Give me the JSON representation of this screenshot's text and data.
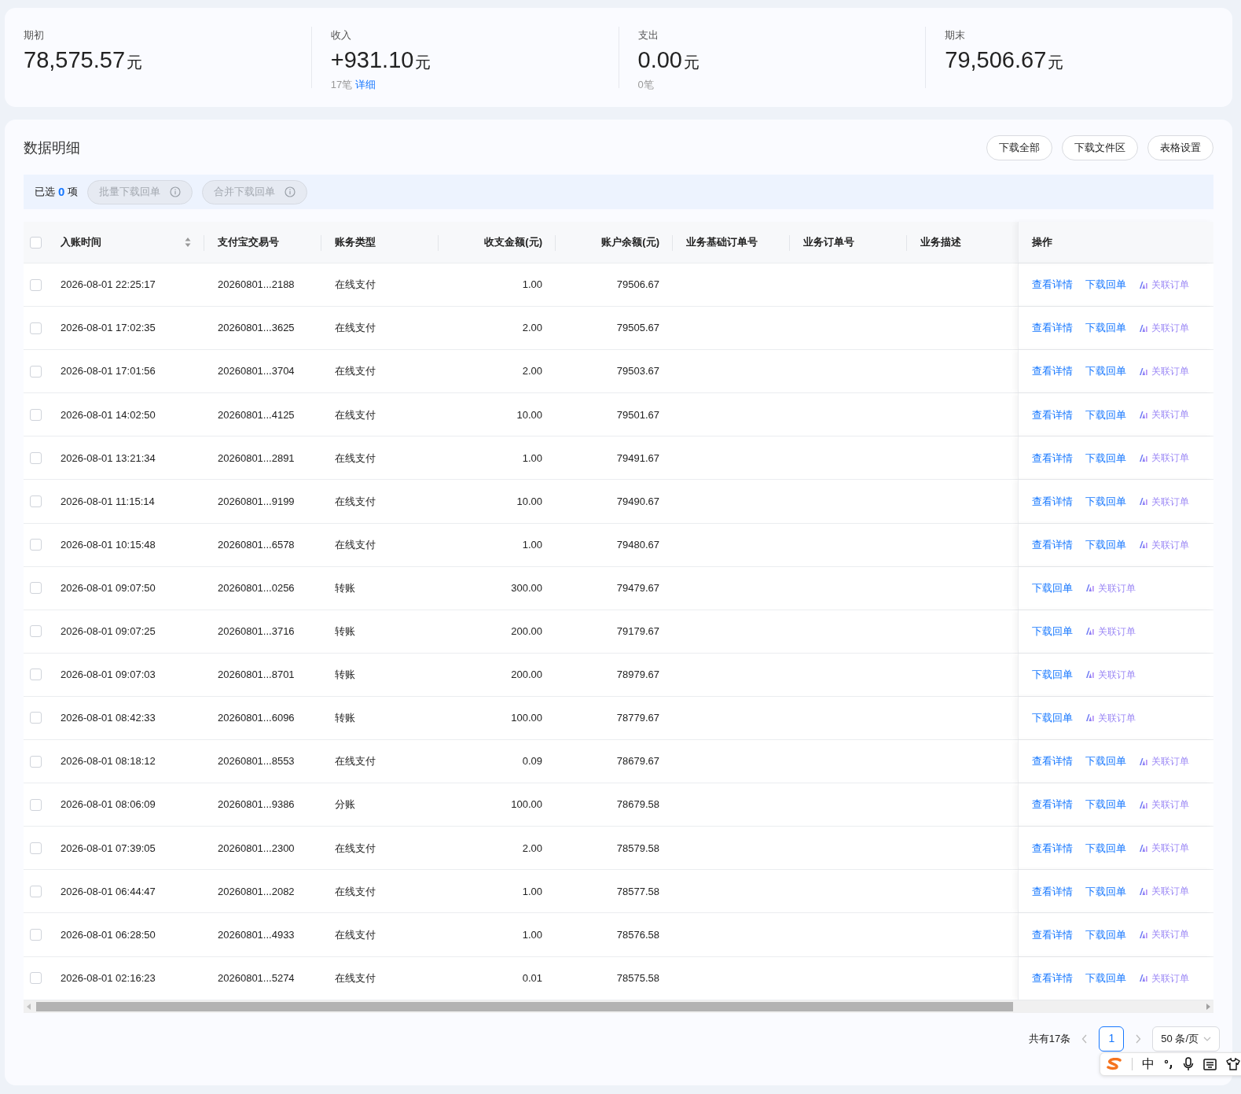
{
  "summary": [
    {
      "label": "期初",
      "amount": "78,575.57",
      "unit": "元"
    },
    {
      "label": "收入",
      "amount": "+931.10",
      "unit": "元",
      "count": "17笔",
      "link": "详细"
    },
    {
      "label": "支出",
      "amount": "0.00",
      "unit": "元",
      "count": "0笔"
    },
    {
      "label": "期末",
      "amount": "79,506.67",
      "unit": "元"
    }
  ],
  "detail": {
    "title": "数据明细",
    "buttons": [
      "下载全部",
      "下载文件区",
      "表格设置"
    ],
    "selection": {
      "prefix": "已选",
      "count": "0",
      "suffix": "项",
      "actions": [
        {
          "label": "批量下载回单",
          "disabled": true
        },
        {
          "label": "合并下载回单",
          "disabled": true
        }
      ]
    },
    "table": {
      "select_all_checked": false,
      "columns": [
        "入账时间",
        "支付宝交易号",
        "账务类型",
        "收支金额(元)",
        "账户余额(元)",
        "业务基础订单号",
        "业务订单号",
        "业务描述",
        "操作"
      ],
      "rows": [
        {
          "checked": false,
          "time": "2026-08-01 22:25:17",
          "txn": "20260801...2188",
          "type": "在线支付",
          "amount": "1.00",
          "balance": "79506.67",
          "actions": [
            {
              "kind": "detail",
              "label": "查看详情"
            },
            {
              "kind": "download",
              "label": "下载回单"
            },
            {
              "kind": "link",
              "label": "关联订单"
            }
          ]
        },
        {
          "checked": false,
          "time": "2026-08-01 17:02:35",
          "txn": "20260801...3625",
          "type": "在线支付",
          "amount": "2.00",
          "balance": "79505.67",
          "actions": [
            {
              "kind": "detail",
              "label": "查看详情"
            },
            {
              "kind": "download",
              "label": "下载回单"
            },
            {
              "kind": "link",
              "label": "关联订单"
            }
          ]
        },
        {
          "checked": false,
          "time": "2026-08-01 17:01:56",
          "txn": "20260801...3704",
          "type": "在线支付",
          "amount": "2.00",
          "balance": "79503.67",
          "actions": [
            {
              "kind": "detail",
              "label": "查看详情"
            },
            {
              "kind": "download",
              "label": "下载回单"
            },
            {
              "kind": "link",
              "label": "关联订单"
            }
          ]
        },
        {
          "checked": false,
          "time": "2026-08-01 14:02:50",
          "txn": "20260801...4125",
          "type": "在线支付",
          "amount": "10.00",
          "balance": "79501.67",
          "actions": [
            {
              "kind": "detail",
              "label": "查看详情"
            },
            {
              "kind": "download",
              "label": "下载回单"
            },
            {
              "kind": "link",
              "label": "关联订单"
            }
          ]
        },
        {
          "checked": false,
          "time": "2026-08-01 13:21:34",
          "txn": "20260801...2891",
          "type": "在线支付",
          "amount": "1.00",
          "balance": "79491.67",
          "actions": [
            {
              "kind": "detail",
              "label": "查看详情"
            },
            {
              "kind": "download",
              "label": "下载回单"
            },
            {
              "kind": "link",
              "label": "关联订单"
            }
          ]
        },
        {
          "checked": false,
          "time": "2026-08-01 11:15:14",
          "txn": "20260801...9199",
          "type": "在线支付",
          "amount": "10.00",
          "balance": "79490.67",
          "actions": [
            {
              "kind": "detail",
              "label": "查看详情"
            },
            {
              "kind": "download",
              "label": "下载回单"
            },
            {
              "kind": "link",
              "label": "关联订单"
            }
          ]
        },
        {
          "checked": false,
          "time": "2026-08-01 10:15:48",
          "txn": "20260801...6578",
          "type": "在线支付",
          "amount": "1.00",
          "balance": "79480.67",
          "actions": [
            {
              "kind": "detail",
              "label": "查看详情"
            },
            {
              "kind": "download",
              "label": "下载回单"
            },
            {
              "kind": "link",
              "label": "关联订单"
            }
          ]
        },
        {
          "checked": false,
          "time": "2026-08-01 09:07:50",
          "txn": "20260801...0256",
          "type": "转账",
          "amount": "300.00",
          "balance": "79479.67",
          "actions": [
            {
              "kind": "download",
              "label": "下载回单"
            },
            {
              "kind": "link",
              "label": "关联订单"
            }
          ]
        },
        {
          "checked": false,
          "time": "2026-08-01 09:07:25",
          "txn": "20260801...3716",
          "type": "转账",
          "amount": "200.00",
          "balance": "79179.67",
          "actions": [
            {
              "kind": "download",
              "label": "下载回单"
            },
            {
              "kind": "link",
              "label": "关联订单"
            }
          ]
        },
        {
          "checked": false,
          "time": "2026-08-01 09:07:03",
          "txn": "20260801...8701",
          "type": "转账",
          "amount": "200.00",
          "balance": "78979.67",
          "actions": [
            {
              "kind": "download",
              "label": "下载回单"
            },
            {
              "kind": "link",
              "label": "关联订单"
            }
          ]
        },
        {
          "checked": false,
          "time": "2026-08-01 08:42:33",
          "txn": "20260801...6096",
          "type": "转账",
          "amount": "100.00",
          "balance": "78779.67",
          "actions": [
            {
              "kind": "download",
              "label": "下载回单"
            },
            {
              "kind": "link",
              "label": "关联订单"
            }
          ]
        },
        {
          "checked": false,
          "time": "2026-08-01 08:18:12",
          "txn": "20260801...8553",
          "type": "在线支付",
          "amount": "0.09",
          "balance": "78679.67",
          "actions": [
            {
              "kind": "detail",
              "label": "查看详情"
            },
            {
              "kind": "download",
              "label": "下载回单"
            },
            {
              "kind": "link",
              "label": "关联订单"
            }
          ]
        },
        {
          "checked": false,
          "time": "2026-08-01 08:06:09",
          "txn": "20260801...9386",
          "type": "分账",
          "amount": "100.00",
          "balance": "78679.58",
          "actions": [
            {
              "kind": "detail",
              "label": "查看详情"
            },
            {
              "kind": "download",
              "label": "下载回单"
            },
            {
              "kind": "link",
              "label": "关联订单"
            }
          ]
        },
        {
          "checked": false,
          "time": "2026-08-01 07:39:05",
          "txn": "20260801...2300",
          "type": "在线支付",
          "amount": "2.00",
          "balance": "78579.58",
          "actions": [
            {
              "kind": "detail",
              "label": "查看详情"
            },
            {
              "kind": "download",
              "label": "下载回单"
            },
            {
              "kind": "link",
              "label": "关联订单"
            }
          ]
        },
        {
          "checked": false,
          "time": "2026-08-01 06:44:47",
          "txn": "20260801...2082",
          "type": "在线支付",
          "amount": "1.00",
          "balance": "78577.58",
          "actions": [
            {
              "kind": "detail",
              "label": "查看详情"
            },
            {
              "kind": "download",
              "label": "下载回单"
            },
            {
              "kind": "link",
              "label": "关联订单"
            }
          ]
        },
        {
          "checked": false,
          "time": "2026-08-01 06:28:50",
          "txn": "20260801...4933",
          "type": "在线支付",
          "amount": "1.00",
          "balance": "78576.58",
          "actions": [
            {
              "kind": "detail",
              "label": "查看详情"
            },
            {
              "kind": "download",
              "label": "下载回单"
            },
            {
              "kind": "link",
              "label": "关联订单"
            }
          ]
        },
        {
          "checked": false,
          "time": "2026-08-01 02:16:23",
          "txn": "20260801...5274",
          "type": "在线支付",
          "amount": "0.01",
          "balance": "78575.58",
          "actions": [
            {
              "kind": "detail",
              "label": "查看详情"
            },
            {
              "kind": "download",
              "label": "下载回单"
            },
            {
              "kind": "link",
              "label": "关联订单"
            }
          ]
        }
      ]
    },
    "pagination": {
      "total": "共有17条",
      "pages": [
        {
          "label": "1",
          "selected": true
        }
      ],
      "page_size": "50 条/页"
    }
  },
  "ime_toolbar": {
    "mode": "中"
  }
}
